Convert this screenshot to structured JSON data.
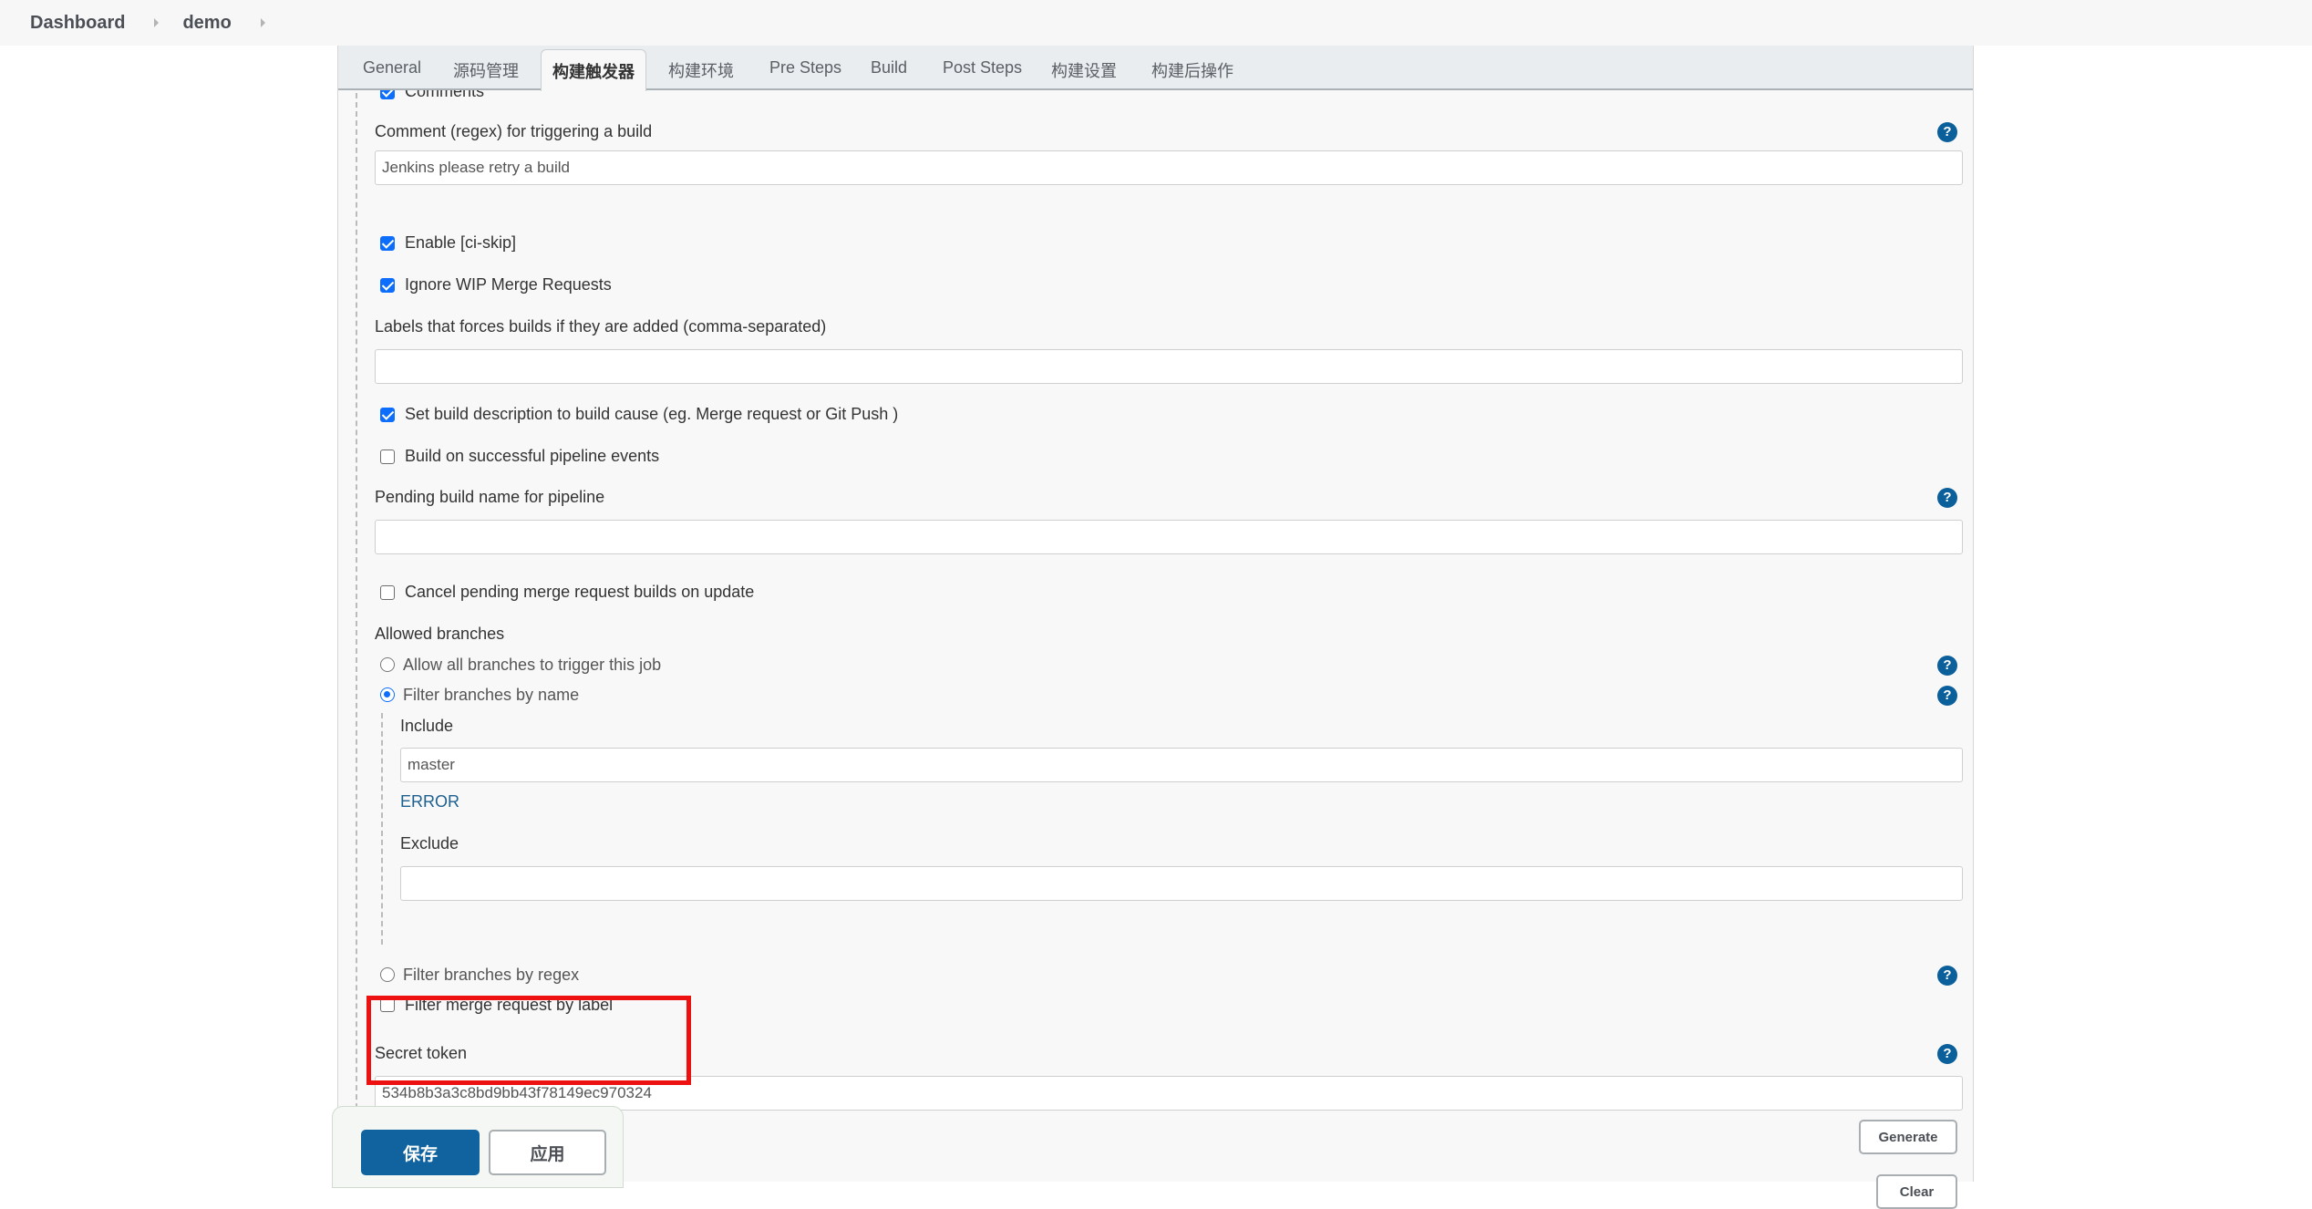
{
  "breadcrumb": [
    "Dashboard",
    "demo"
  ],
  "tabs": [
    {
      "label": "General",
      "active": false
    },
    {
      "label": "源码管理",
      "active": false
    },
    {
      "label": "构建触发器",
      "active": true
    },
    {
      "label": "构建环境",
      "active": false
    },
    {
      "label": "Pre Steps",
      "active": false
    },
    {
      "label": "Build",
      "active": false
    },
    {
      "label": "Post Steps",
      "active": false
    },
    {
      "label": "构建设置",
      "active": false
    },
    {
      "label": "构建后操作",
      "active": false
    }
  ],
  "form": {
    "comments": {
      "label": "Comments",
      "checked": true
    },
    "comment_regex": {
      "label": "Comment (regex) for triggering a build",
      "value": "Jenkins please retry a build"
    },
    "ci_skip": {
      "label": "Enable [ci-skip]",
      "checked": true
    },
    "ignore_wip": {
      "label": "Ignore WIP Merge Requests",
      "checked": true
    },
    "labels_force": {
      "label": "Labels that forces builds if they are added (comma-separated)",
      "value": ""
    },
    "set_build_desc": {
      "label": "Set build description to build cause (eg. Merge request or Git Push )",
      "checked": true
    },
    "build_on_pipeline": {
      "label": "Build on successful pipeline events",
      "checked": false
    },
    "pending_build_name": {
      "label": "Pending build name for pipeline",
      "value": ""
    },
    "cancel_pending": {
      "label": "Cancel pending merge request builds on update",
      "checked": false
    },
    "allowed_branches": {
      "label": "Allowed branches",
      "options": [
        {
          "label": "Allow all branches to trigger this job",
          "selected": false
        },
        {
          "label": "Filter branches by name",
          "selected": true
        },
        {
          "label": "Filter branches by regex",
          "selected": false
        }
      ],
      "include_label": "Include",
      "include_value": "master",
      "error_text": "ERROR",
      "exclude_label": "Exclude",
      "exclude_value": ""
    },
    "filter_by_label": {
      "label": "Filter merge request by label",
      "checked": false
    },
    "secret_token": {
      "label": "Secret token",
      "value": "534b8b3a3c8bd9bb43f78149ec970324"
    },
    "generate_label": "Generate",
    "clear_label": "Clear",
    "help_glyph": "?"
  },
  "footer": {
    "save_label": "保存",
    "apply_label": "应用"
  },
  "colors": {
    "primary": "#10639e",
    "help": "#0b5f9b",
    "checkbox": "#0d6efd",
    "highlight": "#ee1111",
    "error": "#1d5f8f"
  }
}
